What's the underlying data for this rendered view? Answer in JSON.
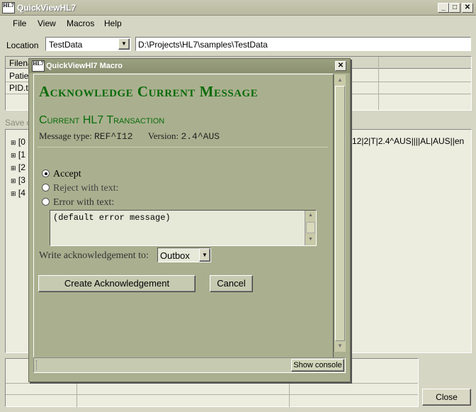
{
  "app": {
    "title": "QuickViewHL7",
    "logo_text": "HL7"
  },
  "menu": [
    "File",
    "View",
    "Macros",
    "Help"
  ],
  "location": {
    "label": "Location",
    "selected": "TestData",
    "path": "D:\\Projects\\HL7\\samples\\TestData"
  },
  "file_table": {
    "header": "Filena",
    "rows": [
      "Patien",
      "PID.tx"
    ]
  },
  "save_label": "Save c",
  "tree": {
    "items": [
      "[0",
      "[1",
      "[2",
      "[3",
      "[4"
    ],
    "message_snippet": "12|2|T|2.4^AUS||||AL|AUS||en"
  },
  "close_button": "Close",
  "dialog": {
    "title": "QuickViewHl7 Macro",
    "heading": "Acknowledge Current Message",
    "section_title": "Current HL7 Transaction",
    "message_type_label": "Message type:",
    "message_type": "REF^I12",
    "version_label": "Version:",
    "version": "2.4^AUS",
    "options": {
      "accept": "Accept",
      "reject": "Reject with text:",
      "error": "Error with text:"
    },
    "selected_option": "accept",
    "text_area_value": "(default error message)",
    "write_label": "Write acknowledgement to:",
    "write_target": "Outbox",
    "create_button": "Create Acknowledgement",
    "cancel_button": "Cancel",
    "show_console": "Show console"
  }
}
